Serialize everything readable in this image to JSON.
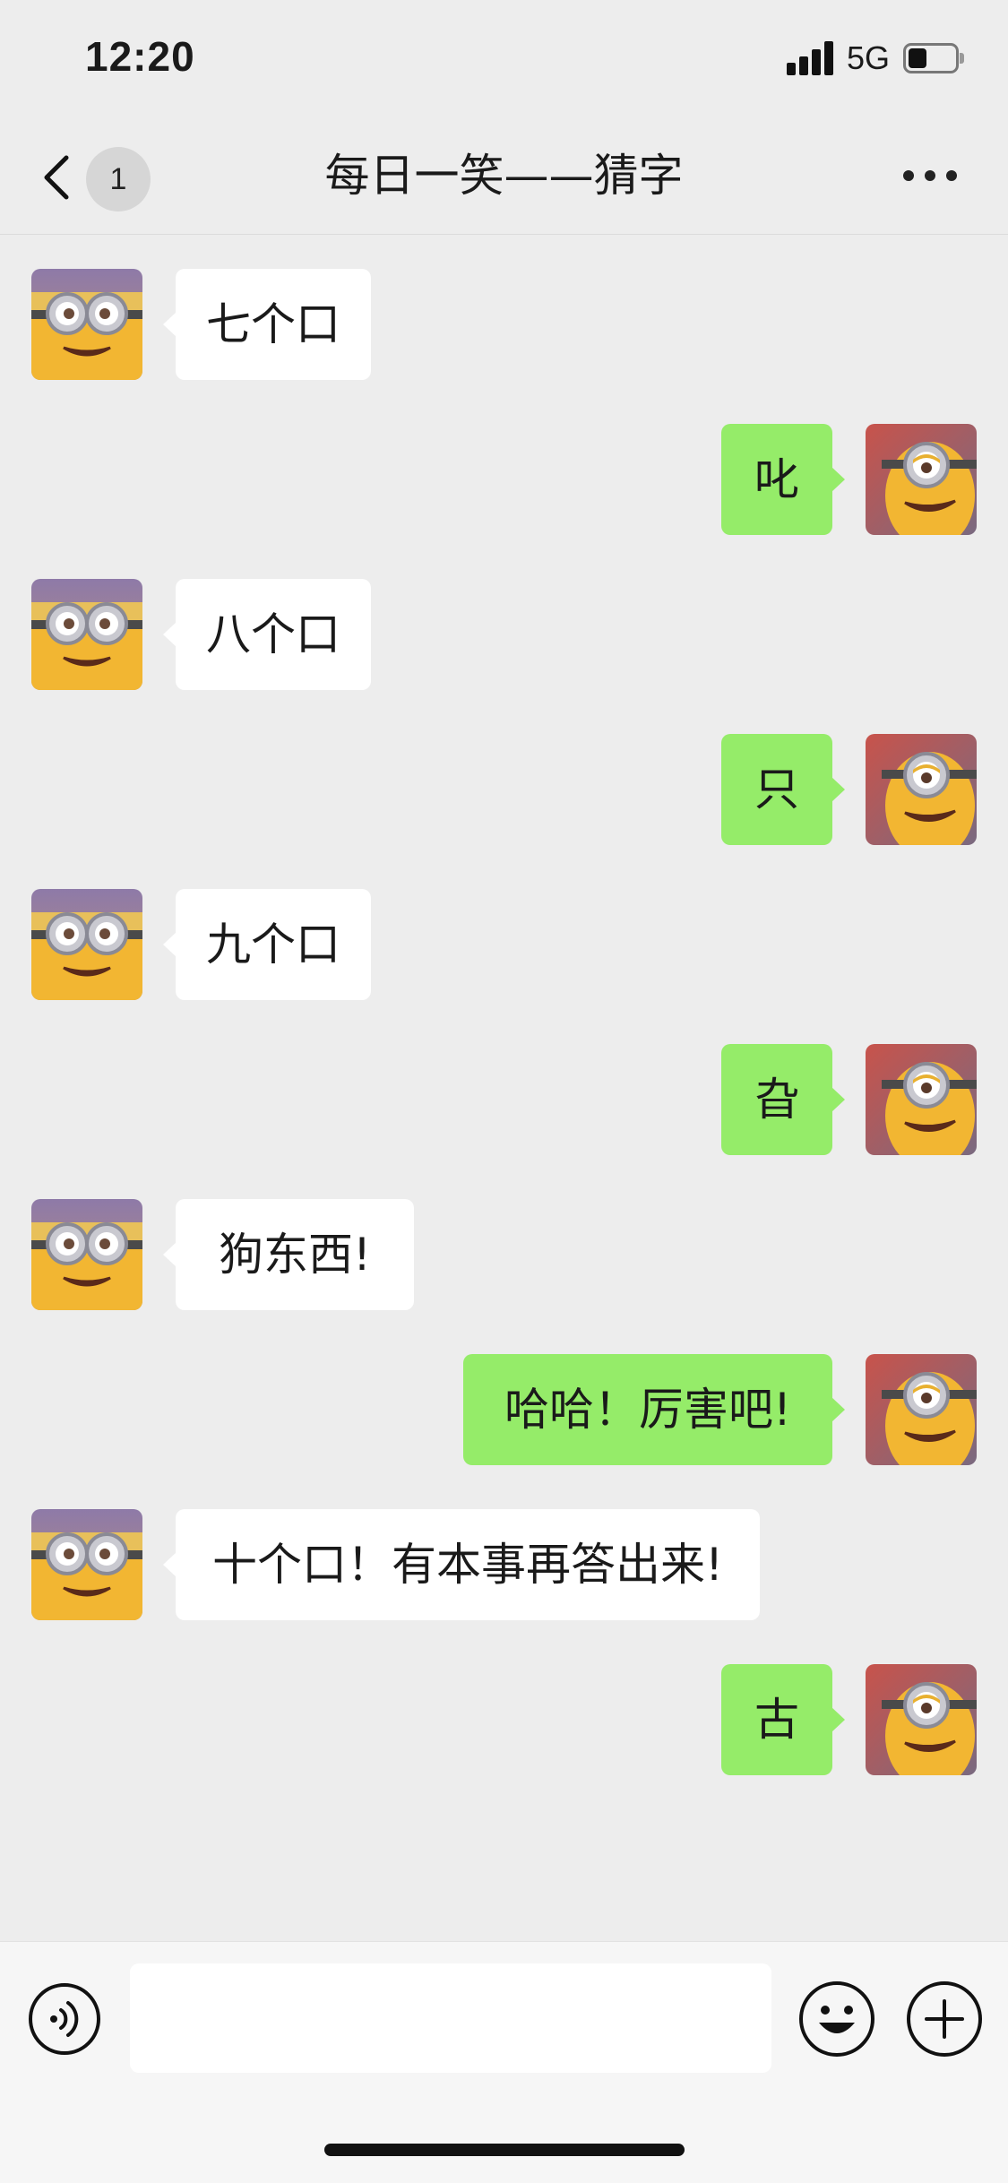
{
  "status_bar": {
    "time": "12:20",
    "network": "5G",
    "battery_fraction": 0.4
  },
  "nav": {
    "back_icon": "chevron-left-icon",
    "unread_count": "1",
    "title": "每日一笑——猜字",
    "more_icon": "more-dots-icon"
  },
  "colors": {
    "background": "#ededed",
    "incoming_bubble": "#ffffff",
    "outgoing_bubble": "#95ec69",
    "input_bar": "#f6f6f6"
  },
  "messages": [
    {
      "side": "left",
      "text": "七个口"
    },
    {
      "side": "right",
      "text": "叱"
    },
    {
      "side": "left",
      "text": "八个口"
    },
    {
      "side": "right",
      "text": "只"
    },
    {
      "side": "left",
      "text": "九个口"
    },
    {
      "side": "right",
      "text": "旮"
    },
    {
      "side": "left",
      "text": "狗东西!"
    },
    {
      "side": "right",
      "text": "哈哈！厉害吧!"
    },
    {
      "side": "left",
      "text": "十个口！有本事再答出来!"
    },
    {
      "side": "right",
      "text": "古"
    }
  ],
  "input_bar": {
    "voice_icon": "voice-input-icon",
    "text_value": "",
    "emoji_icon": "emoji-icon",
    "plus_icon": "plus-icon"
  }
}
